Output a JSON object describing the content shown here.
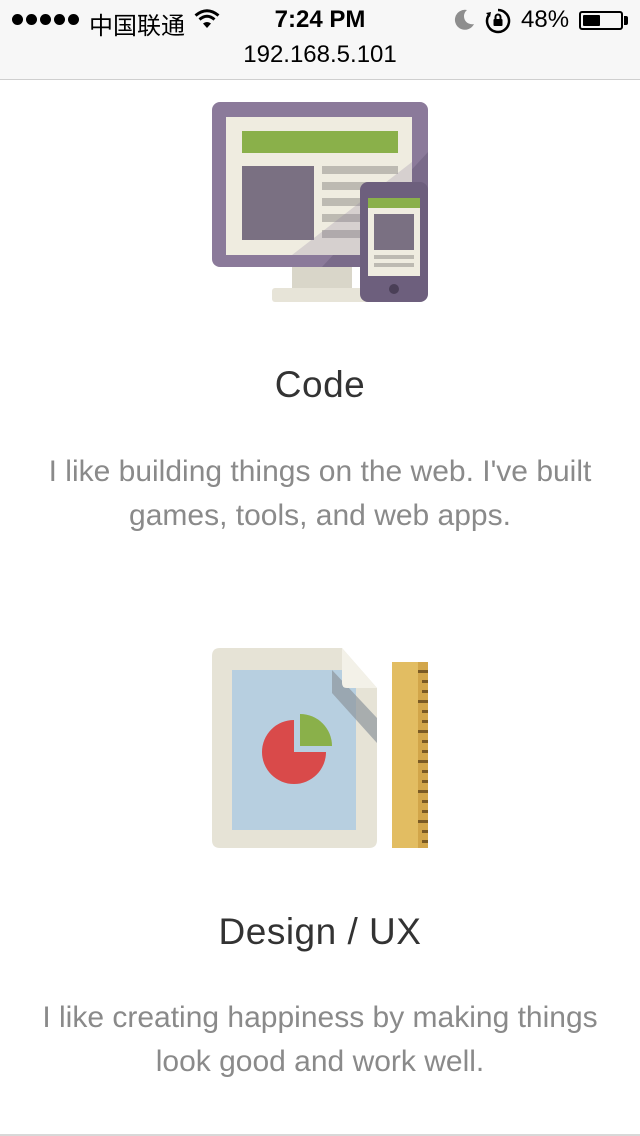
{
  "status_bar": {
    "carrier": "中国联通",
    "time": "7:24 PM",
    "battery_percent": "48%",
    "battery_level": 0.48,
    "signal_bars": 5
  },
  "browser": {
    "url": "192.168.5.101"
  },
  "sections": [
    {
      "icon": "responsive-devices-icon",
      "title": "Code",
      "description": "I like building things on the web. I've built games, tools, and web apps."
    },
    {
      "icon": "design-document-ruler-icon",
      "title": "Design / UX",
      "description": "I like creating happiness by making things look good and work well."
    }
  ],
  "colors": {
    "monitor_purple": "#8b7a9a",
    "accent_green": "#8ab04a",
    "chart_red": "#d94a4a",
    "paper_blue": "#b7cfe0",
    "ruler_gold": "#e2bd62"
  }
}
